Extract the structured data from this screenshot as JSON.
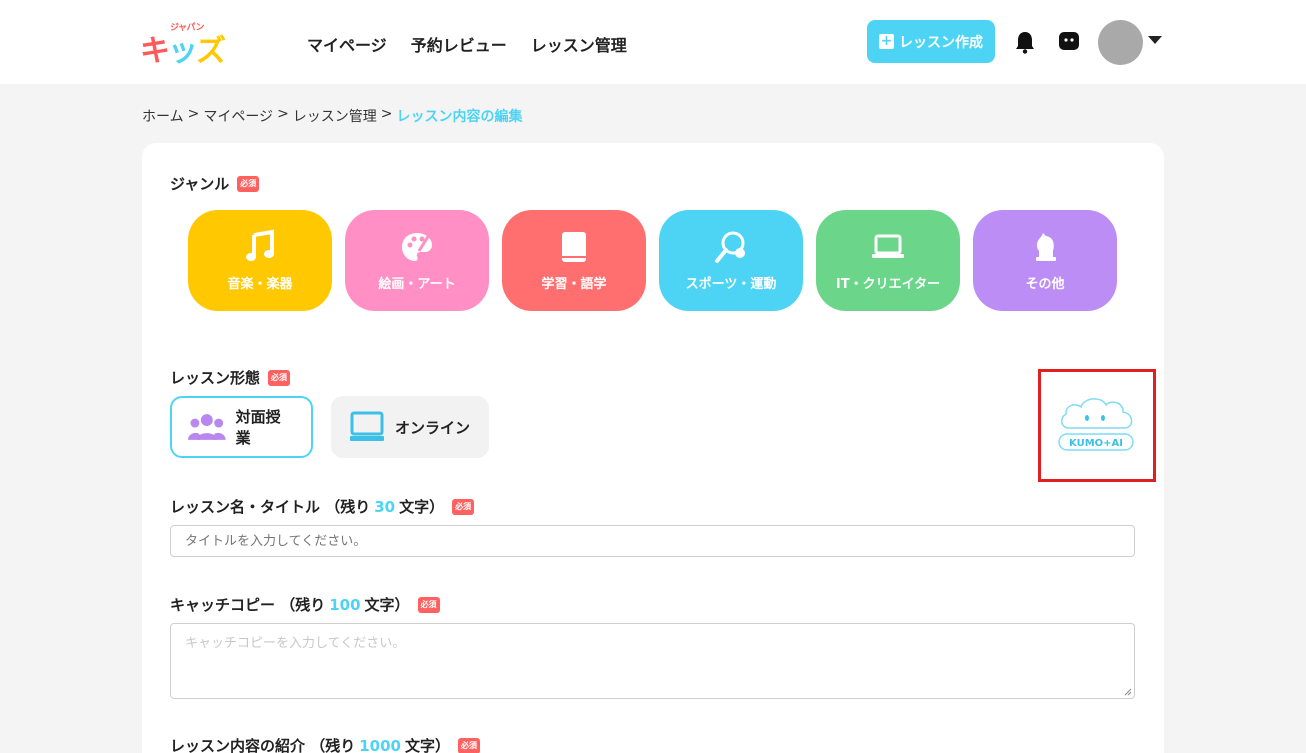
{
  "header": {
    "logo_small": "ジャパン",
    "logo_big": "キッズ",
    "nav": [
      "マイページ",
      "予約レビュー",
      "レッスン管理"
    ],
    "create_button": "レッスン作成",
    "colors": {
      "accent": "#4dd4f5",
      "required": "#ff6060"
    }
  },
  "breadcrumb": {
    "items": [
      "ホーム",
      ">",
      "マイページ",
      ">",
      "レッスン管理",
      ">"
    ],
    "current": "レッスン内容の編集"
  },
  "form": {
    "required_badge": "必須",
    "genre": {
      "label": "ジャンル",
      "options": [
        {
          "label": "音楽・楽器",
          "icon": "music-note-icon",
          "color": "#ffc800"
        },
        {
          "label": "絵画・アート",
          "icon": "palette-icon",
          "color": "#ff8fc5"
        },
        {
          "label": "学習・語学",
          "icon": "book-icon",
          "color": "#ff6f6f"
        },
        {
          "label": "スポーツ・運動",
          "icon": "racket-icon",
          "color": "#4dd4f5"
        },
        {
          "label": "IT・クリエイター",
          "icon": "laptop-icon",
          "color": "#6bd58a"
        },
        {
          "label": "その他",
          "icon": "chess-knight-icon",
          "color": "#bc8ef5"
        }
      ]
    },
    "lesson_format": {
      "label": "レッスン形態",
      "options": [
        {
          "label": "対面授業",
          "icon": "people-icon",
          "selected": true
        },
        {
          "label": "オンライン",
          "icon": "monitor-icon",
          "selected": false
        }
      ]
    },
    "ai_logo_text": "KUMO+AI",
    "title": {
      "label": "レッスン名・タイトル （残り",
      "count": "30",
      "suffix": "文字）",
      "placeholder": "タイトルを入力してください。",
      "value": ""
    },
    "catchcopy": {
      "label": "キャッチコピー （残り",
      "count": "100",
      "suffix": "文字）",
      "placeholder": "キャッチコピーを入力してください。",
      "value": ""
    },
    "intro": {
      "label": "レッスン内容の紹介 （残り",
      "count": "1000",
      "suffix": "文字）"
    }
  }
}
